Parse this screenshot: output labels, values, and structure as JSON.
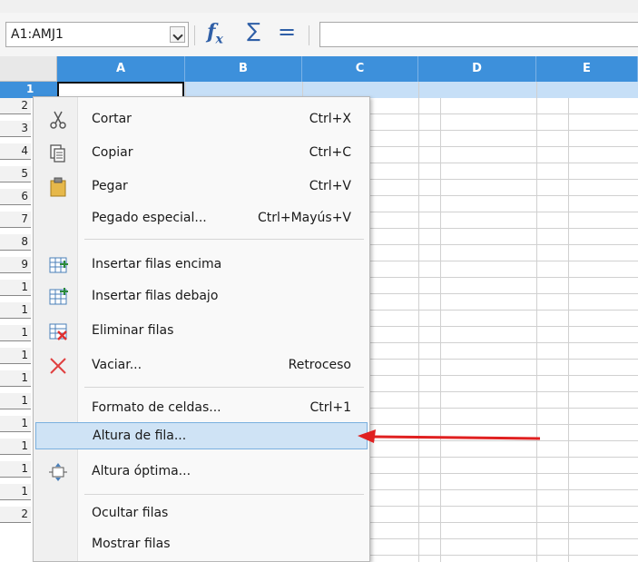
{
  "namebox": {
    "value": "A1:AMJ1"
  },
  "formula": {
    "fx_icon": "function-wizard-icon",
    "sum_icon": "sum-icon",
    "eq_icon": "equals-icon",
    "value": ""
  },
  "columns": [
    "A",
    "B",
    "C",
    "D",
    "E"
  ],
  "rows": [
    "1",
    "2",
    "3",
    "4",
    "5",
    "6",
    "7",
    "8",
    "9",
    "1",
    "1",
    "1",
    "1",
    "1",
    "1",
    "1",
    "1",
    "1",
    "1",
    "2"
  ],
  "context_menu": {
    "items": [
      {
        "label": "Cortar",
        "shortcut": "Ctrl+X",
        "icon": "scissors-icon"
      },
      {
        "label": "Copiar",
        "shortcut": "Ctrl+C",
        "icon": "copy-icon"
      },
      {
        "label": "Pegar",
        "shortcut": "Ctrl+V",
        "icon": "paste-icon"
      },
      {
        "label": "Pegado especial...",
        "shortcut": "Ctrl+Mayús+V",
        "icon": ""
      },
      {
        "label": "Insertar filas encima",
        "shortcut": "",
        "icon": "insert-rows-above-icon"
      },
      {
        "label": "Insertar filas debajo",
        "shortcut": "",
        "icon": "insert-rows-below-icon"
      },
      {
        "label": "Eliminar filas",
        "shortcut": "",
        "icon": "delete-rows-icon"
      },
      {
        "label": "Vaciar...",
        "shortcut": "Retroceso",
        "icon": "clear-x-icon"
      },
      {
        "label": "Formato de celdas...",
        "shortcut": "Ctrl+1",
        "icon": ""
      },
      {
        "label": "Altura de fila...",
        "shortcut": "",
        "icon": ""
      },
      {
        "label": "Altura óptima...",
        "shortcut": "",
        "icon": "optimal-height-icon"
      },
      {
        "label": "Ocultar filas",
        "shortcut": "",
        "icon": ""
      },
      {
        "label": "Mostrar filas",
        "shortcut": "",
        "icon": ""
      }
    ],
    "highlighted": "Altura de fila..."
  },
  "annotation": {
    "arrow_color": "#e02020",
    "icon": "red-arrow-icon"
  },
  "colors": {
    "header_blue": "#3d90db",
    "selection": "#c6dff7"
  }
}
